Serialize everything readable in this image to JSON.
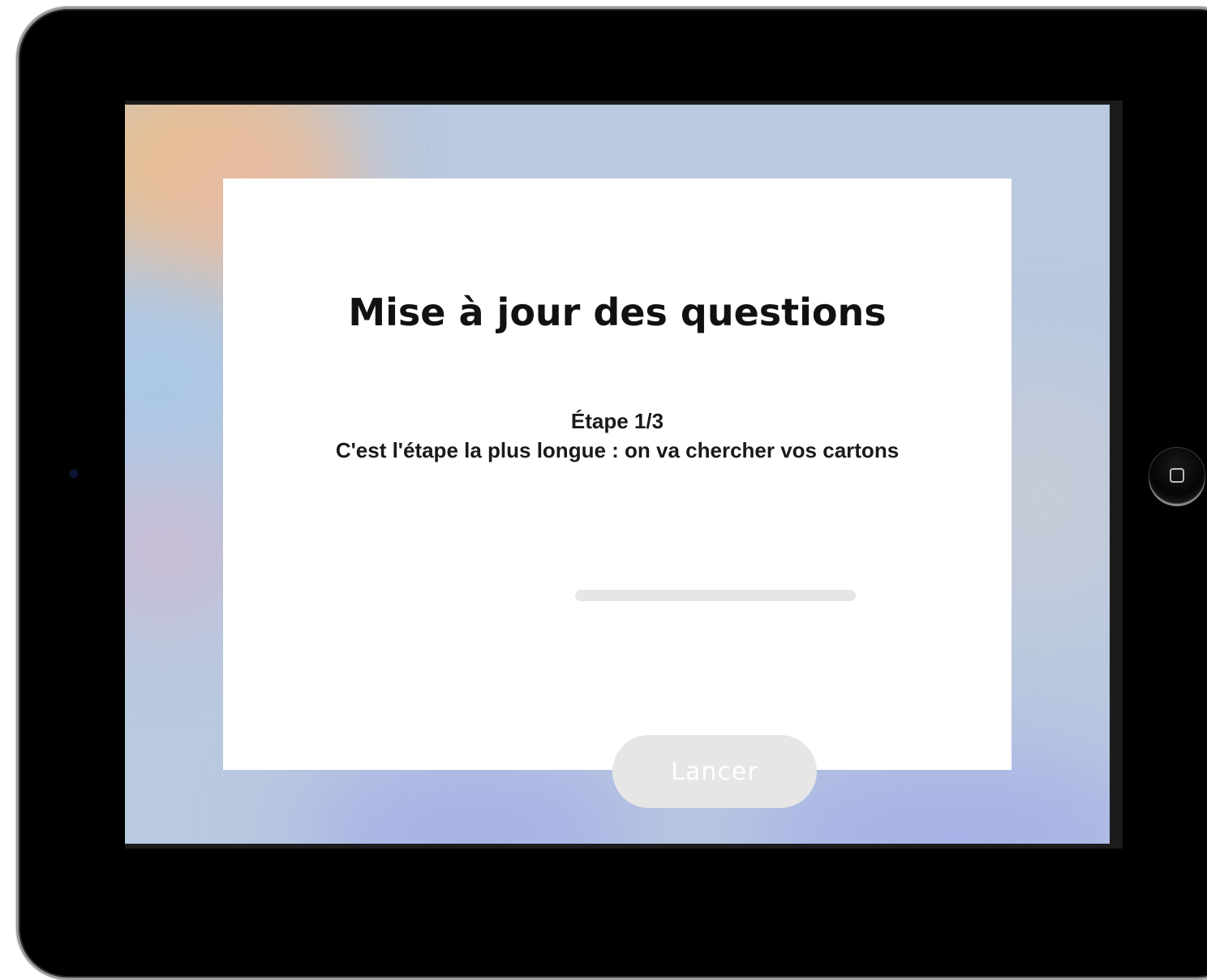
{
  "dialog": {
    "title": "Mise à jour des questions",
    "step_label": "Étape 1/3",
    "step_description": "C'est l'étape la plus longue : on va chercher vos cartons"
  },
  "progress": {
    "fraction": 0
  },
  "launch_button": {
    "label": "Lancer",
    "enabled": false
  },
  "device": {
    "home_button_icon": "square-icon"
  },
  "colors": {
    "title": "#111111",
    "button_disabled_bg": "#e6e6e6",
    "button_text": "#ffffff",
    "progress_track": "#e6e6e6"
  }
}
